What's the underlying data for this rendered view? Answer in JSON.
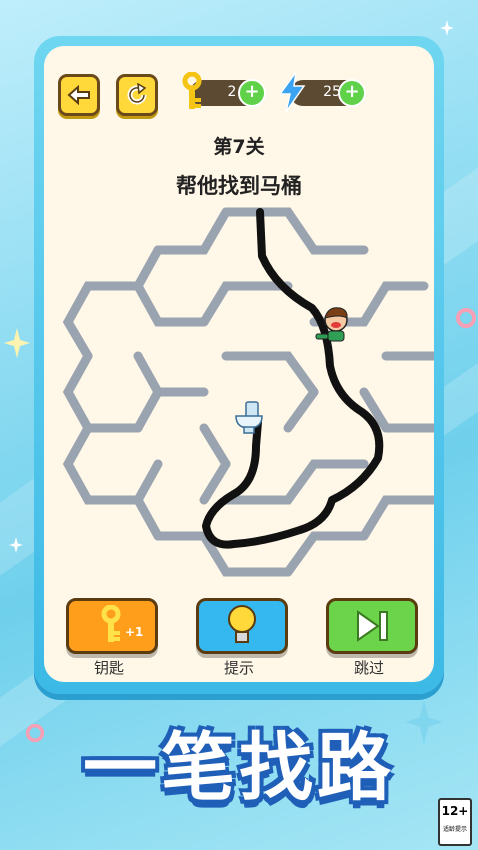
{
  "header": {
    "keys_count": "2",
    "energy_count": "25",
    "plus_symbol": "+"
  },
  "level": {
    "title": "第7关",
    "goal": "帮他找到马桶"
  },
  "tools": [
    {
      "label": "钥匙",
      "badge": "+1",
      "color": "#ff9e1b"
    },
    {
      "label": "提示",
      "color": "#35b7f0"
    },
    {
      "label": "跳过",
      "color": "#6cd44a"
    }
  ],
  "banner": "一笔找路",
  "age_rating": {
    "number": "12+",
    "sub": "适龄提示"
  },
  "colors": {
    "frame": "#3cb9e6",
    "panel": "#fff7e7",
    "button": "#ffd83a",
    "maze_wall": "#9aa3b0",
    "path": "#111111"
  },
  "icons": [
    "back-arrow-icon",
    "restart-icon",
    "key-icon",
    "lightning-icon",
    "plus-icon",
    "lightbulb-icon",
    "skip-icon",
    "toilet-icon",
    "character-icon"
  ]
}
